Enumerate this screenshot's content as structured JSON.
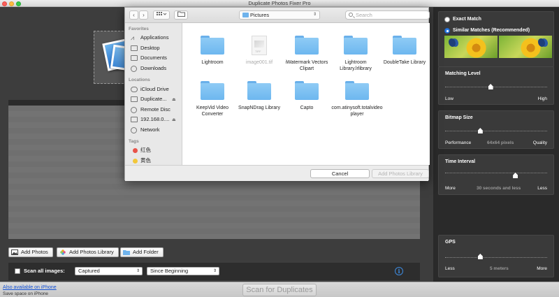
{
  "window": {
    "title": "Duplicate Photos Fixer Pro"
  },
  "main": {
    "add_photos_label": "Add Photos",
    "add_library_label": "Add Photos Library",
    "add_folder_label": "Add Folder",
    "scan_all_label": "Scan all images:",
    "captured_value": "Captured",
    "since_value": "Since Beginning",
    "scan_all_checked": false
  },
  "right_panel": {
    "exact_match": "Exact Match",
    "similar_matches": "Similar Matches (Recommended)",
    "selected_mode": "Similar Matches (Recommended)",
    "matching_level": {
      "title": "Matching Level",
      "low": "Low",
      "high": "High",
      "value_fraction": 0.44
    },
    "bitmap_size": {
      "title": "Bitmap Size",
      "left": "Performance",
      "middle": "64x64 pixels",
      "right": "Quality",
      "value_fraction": 0.34
    },
    "time_interval": {
      "title": "Time Interval",
      "left": "More",
      "middle": "30 seconds and less",
      "right": "Less",
      "value_fraction": 0.68
    },
    "gps": {
      "title": "GPS",
      "left": "Less",
      "middle": "5 meters",
      "right": "More",
      "value_fraction": 0.34
    }
  },
  "bottom": {
    "link": "Also available on iPhone",
    "sub": "Save space on iPhone",
    "scan_button": "Scan for Duplicates"
  },
  "dialog": {
    "location": "Pictures",
    "search_placeholder": "Search",
    "sidebar": {
      "favorites_heading": "Favorites",
      "favorites": [
        "Applications",
        "Desktop",
        "Documents",
        "Downloads"
      ],
      "locations_heading": "Locations",
      "locations": [
        "iCloud Drive",
        "Duplicate...",
        "Remote Disc",
        "192.168.0....",
        "Network"
      ],
      "tags_heading": "Tags",
      "tags": [
        "红色",
        "黄色"
      ]
    },
    "files": [
      {
        "name": "Lightroom",
        "kind": "folder"
      },
      {
        "name": "image001.tif",
        "kind": "file"
      },
      {
        "name": "iWatermark Vectors Clipart",
        "kind": "folder"
      },
      {
        "name": "Lightroom Library.lrlibrary",
        "kind": "folder"
      },
      {
        "name": "DoubleTake Library",
        "kind": "folder"
      },
      {
        "name": "KeepVid Video Converter",
        "kind": "folder"
      },
      {
        "name": "SnapNDrag Library",
        "kind": "folder"
      },
      {
        "name": "Capto",
        "kind": "folder"
      },
      {
        "name": "com.atinysoft.totalvideoplayer",
        "kind": "folder"
      }
    ],
    "tif_tag": "TIFF",
    "cancel_label": "Cancel",
    "add_library_label": "Add Photos Library"
  },
  "colors": {
    "accent": "#2d7ee8",
    "folder": "#7dc0f2",
    "tag_red": "#e8534a",
    "tag_yellow": "#f2c73a"
  }
}
